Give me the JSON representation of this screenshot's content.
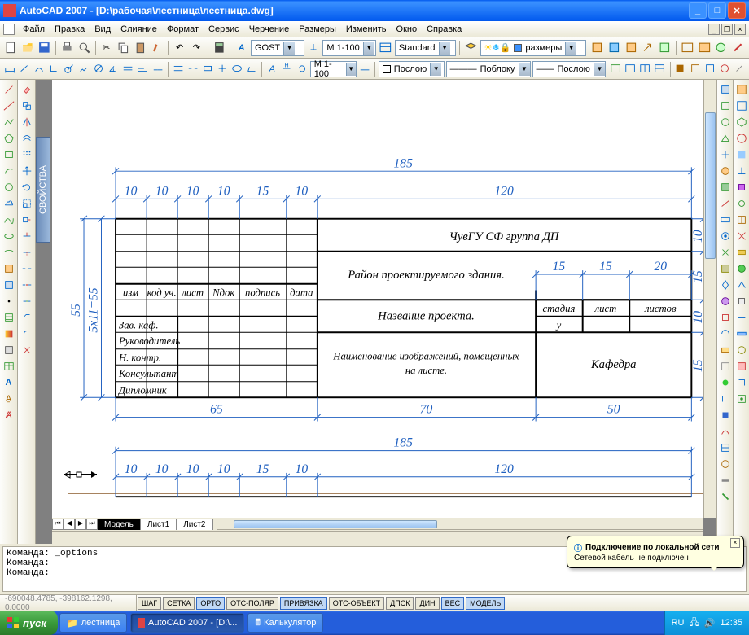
{
  "window": {
    "title": "AutoCAD 2007 - [D:\\рабочая\\лестница\\лестница.dwg]"
  },
  "menu": [
    "Файл",
    "Правка",
    "Вид",
    "Слияние",
    "Формат",
    "Сервис",
    "Черчение",
    "Размеры",
    "Изменить",
    "Окно",
    "Справка"
  ],
  "toolbar1": {
    "font_style": "GOST",
    "annot": "M 1-100",
    "dim_style": "Standard",
    "layer": "размеры"
  },
  "toolbar2": {
    "scale": "M 1-100",
    "color": "Послою",
    "ltype": "Поблоку",
    "lweight": "Послою"
  },
  "prop_panel": "СВОЙСТВА",
  "drawing": {
    "top_dims": [
      "185",
      "10",
      "10",
      "10",
      "10",
      "15",
      "10",
      "120"
    ],
    "left_dim_total": "55",
    "left_dim_expr": "5x11=55",
    "right_dims": [
      "10",
      "15",
      "10",
      "15"
    ],
    "right_h_dims": [
      "15",
      "15",
      "20"
    ],
    "bottom_dims": [
      "65",
      "70",
      "50"
    ],
    "row_headers": [
      "изм",
      "код уч.",
      "лист",
      "Nдок",
      "подпись",
      "дата"
    ],
    "roles": [
      "Зав. каф.",
      "Руководитель",
      "Н. контр.",
      "Консультант",
      "Дипломник"
    ],
    "block_r1": "ЧувГУ СФ группа ДП",
    "block_r2": "Район проектируемого здания.",
    "block_r3": "Название проекта.",
    "block_r4": "Наименование изображений, помещенных на листе.",
    "small_hdr": [
      "стадия",
      "лист",
      "листов"
    ],
    "small_val": "у",
    "block_r5": "Кафедра",
    "bottom_top_dims": [
      "185",
      "10",
      "10",
      "10",
      "10",
      "15",
      "10",
      "120"
    ]
  },
  "tabs": [
    "Модель",
    "Лист1",
    "Лист2"
  ],
  "cmd": {
    "l1": "Команда: _options",
    "l2": "Команда:",
    "l3": "Команда:"
  },
  "status": {
    "coords": "-690048.4785, -398162.1298, 0.0000",
    "toggles": [
      "ШАГ",
      "СЕТКА",
      "ОРТО",
      "ОТС-ПОЛЯР",
      "ПРИВЯЗКА",
      "ОТС-ОБЪЕКТ",
      "ДПСК",
      "ДИН",
      "ВЕС",
      "МОДЕЛЬ"
    ]
  },
  "balloon": {
    "title": "Подключение по локальной сети",
    "body": "Сетевой кабель не подключен"
  },
  "taskbar": {
    "start": "пуск",
    "items": [
      "лестница",
      "AutoCAD 2007 - [D:\\...",
      "Калькулятор"
    ],
    "lang": "RU",
    "clock": "12:35"
  }
}
